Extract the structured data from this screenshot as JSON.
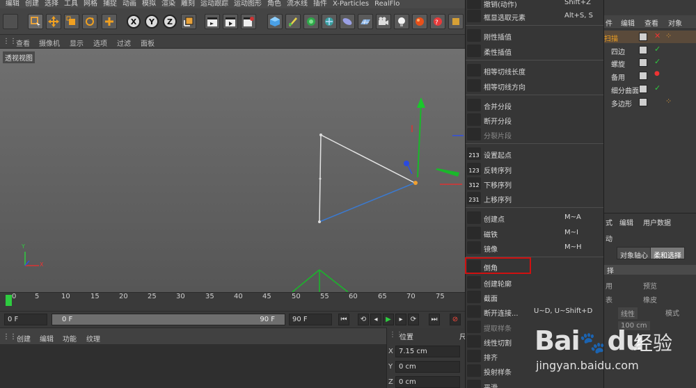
{
  "menubar": {
    "items": [
      "编辑",
      "创建",
      "选择",
      "工具",
      "网格",
      "捕捉",
      "动画",
      "模拟",
      "渲染",
      "雕刻",
      "运动跟踪",
      "运动图形",
      "角色",
      "流水线",
      "插件",
      "X-Particles",
      "RealFlo"
    ]
  },
  "toolbar": {
    "axes": [
      "X",
      "Y",
      "Z"
    ]
  },
  "viewport_menu": {
    "items": [
      "查看",
      "摄像机",
      "显示",
      "选项",
      "过滤",
      "面板"
    ]
  },
  "viewport": {
    "label": "透视视图",
    "axis_y": "Y",
    "axis_x": "X"
  },
  "timeline": {
    "ticks": [
      "0",
      "5",
      "10",
      "15",
      "20",
      "25",
      "30",
      "35",
      "40",
      "45",
      "50",
      "55",
      "60",
      "65",
      "70",
      "75"
    ],
    "current_frame": 0
  },
  "transport": {
    "start_field": "0 F",
    "slider_start": "0 F",
    "slider_end": "90 F",
    "end_field": "90 F"
  },
  "lower_panel": {
    "menu": [
      "创建",
      "编辑",
      "功能",
      "纹理"
    ]
  },
  "coords": {
    "header": "位置",
    "header2": "尺",
    "rows": [
      {
        "axis": "X",
        "value": "7.15 cm"
      },
      {
        "axis": "Y",
        "value": "0 cm"
      },
      {
        "axis": "Z",
        "value": "0 cm"
      }
    ]
  },
  "context_menu": {
    "items": [
      {
        "label": "撤销(动作)",
        "shortcut": "Shift+Z"
      },
      {
        "label": "框显选取元素",
        "shortcut": "Alt+S, S"
      },
      {
        "label": "刚性插值",
        "shortcut": ""
      },
      {
        "label": "柔性插值",
        "shortcut": ""
      },
      {
        "label": "相等切线长度",
        "shortcut": ""
      },
      {
        "label": "相等切线方向",
        "shortcut": ""
      },
      {
        "label": "合并分段",
        "shortcut": ""
      },
      {
        "label": "断开分段",
        "shortcut": ""
      },
      {
        "label": "分裂片段",
        "shortcut": ""
      },
      {
        "label": "设置起点",
        "shortcut": ""
      },
      {
        "label": "反转序列",
        "shortcut": ""
      },
      {
        "label": "下移序列",
        "shortcut": ""
      },
      {
        "label": "上移序列",
        "shortcut": ""
      },
      {
        "label": "创建点",
        "shortcut": "M~A"
      },
      {
        "label": "磁铁",
        "shortcut": "M~I"
      },
      {
        "label": "镜像",
        "shortcut": "M~H"
      },
      {
        "label": "倒角",
        "shortcut": ""
      },
      {
        "label": "创建轮廓",
        "shortcut": ""
      },
      {
        "label": "截面",
        "shortcut": ""
      },
      {
        "label": "断开连接...",
        "shortcut": "U~D, U~Shift+D"
      },
      {
        "label": "提取样条",
        "shortcut": ""
      },
      {
        "label": "线性切割",
        "shortcut": ""
      },
      {
        "label": "排齐",
        "shortcut": ""
      },
      {
        "label": "投射样条",
        "shortcut": ""
      },
      {
        "label": "平滑",
        "shortcut": ""
      }
    ],
    "icon_numbers": [
      "213",
      "123",
      "312",
      "231"
    ],
    "highlighted": "倒角"
  },
  "object_manager": {
    "tabs": [
      "件",
      "编辑",
      "查看",
      "对象"
    ],
    "objects": [
      {
        "name": "扫描"
      },
      {
        "name": "四边"
      },
      {
        "name": "螺旋"
      },
      {
        "name": "备用"
      },
      {
        "name": "细分曲面"
      },
      {
        "name": "多边形"
      }
    ]
  },
  "attributes": {
    "tabs": [
      "式",
      "编辑",
      "用户数据"
    ],
    "line1": "动",
    "buttons": [
      "对象轴心",
      "柔和选择"
    ],
    "section": "择",
    "t1": "用",
    "t2": "预览",
    "t3": "橡皮",
    "t4": "表",
    "t5": "线性",
    "t6": "模式",
    "t7": "100 cm"
  },
  "watermark": {
    "brand": "Bai",
    "brand2": "du",
    "cn": "经验",
    "url": "jingyan.baidu.com"
  }
}
